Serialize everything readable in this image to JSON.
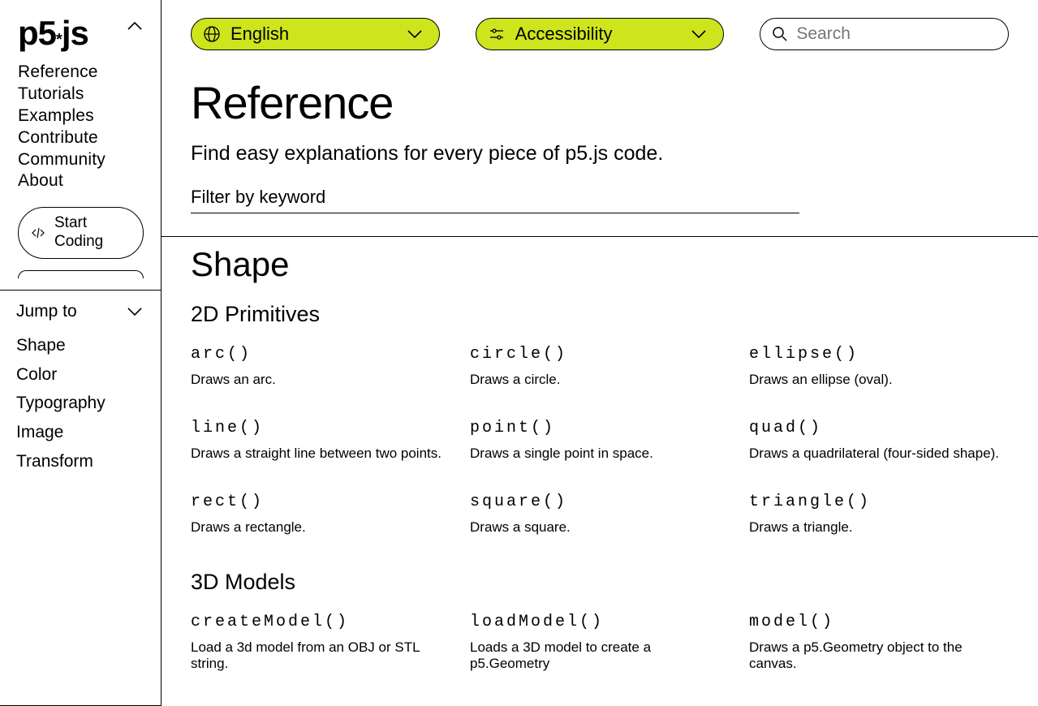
{
  "sidebar": {
    "logo": "p5*js",
    "nav": [
      "Reference",
      "Tutorials",
      "Examples",
      "Contribute",
      "Community",
      "About"
    ],
    "startCoding": {
      "line1": "Start",
      "line2": "Coding"
    },
    "jumpTo": "Jump to",
    "jumpList": [
      "Shape",
      "Color",
      "Typography",
      "Image",
      "Transform"
    ]
  },
  "topbar": {
    "language": "English",
    "accessibility": "Accessibility",
    "searchPlaceholder": "Search"
  },
  "page": {
    "title": "Reference",
    "desc": "Find easy explanations for every piece of p5.js code.",
    "filterPlaceholder": "Filter by keyword"
  },
  "section": {
    "title": "Shape",
    "sub1": {
      "title": "2D Primitives",
      "items": [
        {
          "fn": "arc()",
          "desc": "Draws an arc."
        },
        {
          "fn": "circle()",
          "desc": "Draws a circle."
        },
        {
          "fn": "ellipse()",
          "desc": "Draws an ellipse (oval)."
        },
        {
          "fn": "line()",
          "desc": "Draws a straight line between two points."
        },
        {
          "fn": "point()",
          "desc": "Draws a single point in space."
        },
        {
          "fn": "quad()",
          "desc": "Draws a quadrilateral (four-sided shape)."
        },
        {
          "fn": "rect()",
          "desc": "Draws a rectangle."
        },
        {
          "fn": "square()",
          "desc": "Draws a square."
        },
        {
          "fn": "triangle()",
          "desc": "Draws a triangle."
        }
      ]
    },
    "sub2": {
      "title": "3D Models",
      "items": [
        {
          "fn": "createModel()",
          "desc": "Load a 3d model from an OBJ or STL string."
        },
        {
          "fn": "loadModel()",
          "desc": "Loads a 3D model to create a p5.Geometry"
        },
        {
          "fn": "model()",
          "desc": "Draws a p5.Geometry object to the canvas."
        }
      ]
    }
  }
}
